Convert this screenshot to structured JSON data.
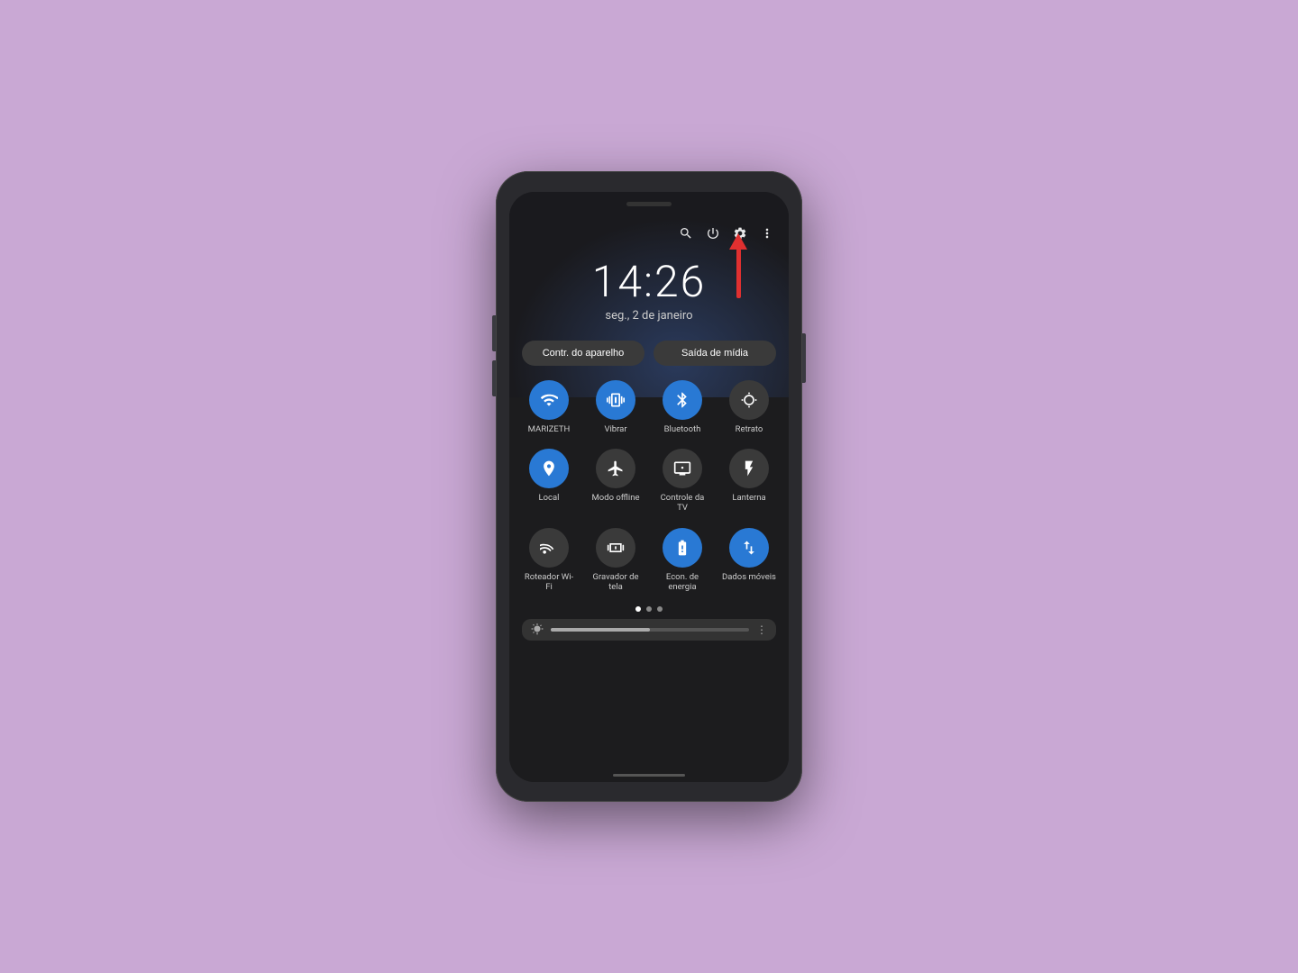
{
  "background_color": "#c9a8d4",
  "phone": {
    "clock": {
      "time": "14:26",
      "date": "seg., 2 de janeiro"
    },
    "top_icons": {
      "search": "🔍",
      "power": "⏻",
      "settings": "⚙",
      "more": "⋮"
    },
    "quick_buttons": [
      {
        "label": "Contr. do aparelho",
        "id": "contr-aparelho"
      },
      {
        "label": "Saída de mídia",
        "id": "saida-midia"
      }
    ],
    "tiles": [
      [
        {
          "label": "MARIZETH",
          "active": true,
          "icon": "wifi",
          "id": "wifi-tile"
        },
        {
          "label": "Vibrar",
          "active": true,
          "icon": "vibrate",
          "id": "vibrar-tile"
        },
        {
          "label": "Bluetooth",
          "active": true,
          "icon": "bluetooth",
          "id": "bluetooth-tile"
        },
        {
          "label": "Retrato",
          "active": false,
          "icon": "lock-rotate",
          "id": "retrato-tile"
        }
      ],
      [
        {
          "label": "Local",
          "active": true,
          "icon": "location",
          "id": "local-tile"
        },
        {
          "label": "Modo offline",
          "active": false,
          "icon": "airplane",
          "id": "modo-offline-tile"
        },
        {
          "label": "Controle da TV",
          "active": false,
          "icon": "tv",
          "id": "controle-tv-tile"
        },
        {
          "label": "Lanterna",
          "active": false,
          "icon": "flashlight",
          "id": "lanterna-tile"
        }
      ],
      [
        {
          "label": "Roteador Wi-Fi",
          "active": false,
          "icon": "rss",
          "id": "roteador-tile"
        },
        {
          "label": "Gravador de tela",
          "active": false,
          "icon": "screen-record",
          "id": "gravador-tile"
        },
        {
          "label": "Econ. de energia",
          "active": true,
          "icon": "battery",
          "id": "econ-tile"
        },
        {
          "label": "Dados móveis",
          "active": true,
          "icon": "data",
          "id": "dados-tile"
        }
      ]
    ],
    "pagination": {
      "total": 3,
      "active": 0
    },
    "brightness": {
      "value": 50
    }
  }
}
